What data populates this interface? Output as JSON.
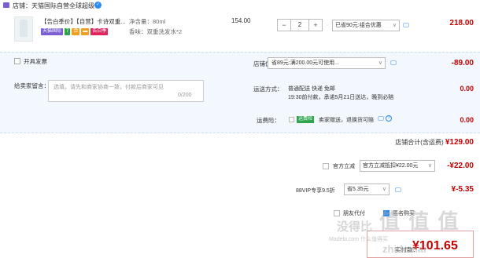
{
  "shop": {
    "label": "店铺：天猫国际自营全球超级"
  },
  "item": {
    "title": "【告白季价】【自营】卡诗双重...",
    "tags": [
      {
        "text": "天猫国际",
        "color": "#7b5fd1"
      },
      {
        "text": "7",
        "color": "#2da44e"
      },
      {
        "text": "合",
        "color": "#f0a020"
      },
      {
        "text": "▬",
        "color": "#f0a020"
      },
      {
        "text": "告白季",
        "color": "#e0245e"
      }
    ],
    "spec_volume": "净含量：80ml",
    "spec_scent": "香味：双重洗发水*2",
    "unit_price": "154.00",
    "quantity": "2",
    "decrement": "−",
    "increment": "+",
    "promo": "已省90元:组合优惠",
    "total": "218.00"
  },
  "invoice": {
    "label": "开具发票"
  },
  "message": {
    "label": "给卖家留言：",
    "placeholder": "选填，请先和商家协商一致，付款后商家可见",
    "count": "0/200"
  },
  "shop_discount": {
    "label": "店铺优惠：",
    "value": "省89元:满200.00元可使用...",
    "amount": "-89.00"
  },
  "shipping": {
    "label": "运送方式：",
    "method": "普通配送 快递 免邮",
    "time": "19:30前付款，承诺5月21日送达，晚到必赔",
    "amount": "0.00"
  },
  "insurance": {
    "label": "运费险：",
    "badge": "运费险",
    "text": "卖家赠送，退换货可赔",
    "help": "?",
    "amount": "0.00"
  },
  "shop_total": {
    "label": "店铺合计(含运费)",
    "value": "¥129.00"
  },
  "official": {
    "label": "官方立减",
    "value": "官方立减抵扣¥22.00元",
    "amount": "-¥22.00"
  },
  "vip": {
    "label": "88VIP专享9.5折",
    "value": "省5.35元",
    "amount": "¥-5.35"
  },
  "options": {
    "friend_pay": "朋友代付",
    "anonymous": "匿名购买"
  },
  "payment": {
    "label": "实付款：",
    "amount": "¥101.65"
  },
  "watermark": {
    "text1": "没得比",
    "text2": "值 值 值",
    "text3": "Madebi.com 什么值得买",
    "text4": "zhidemai"
  },
  "colors": {
    "price_red": "#c40000",
    "link_blue": "#2a8cf0",
    "panel_bg": "#f3f8fe"
  }
}
